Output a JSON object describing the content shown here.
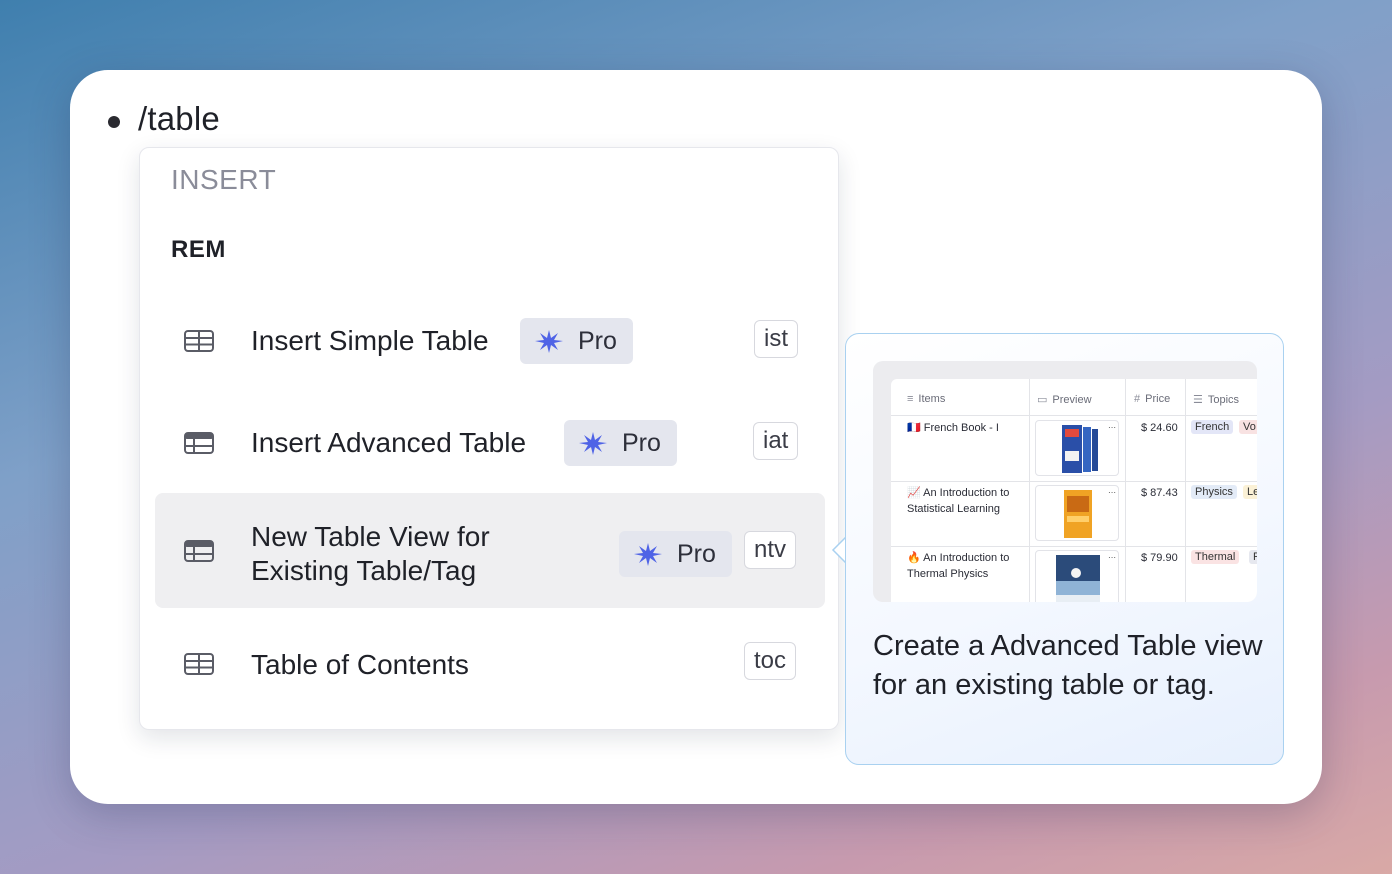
{
  "editor": {
    "command": "/table"
  },
  "menu": {
    "section": "INSERT",
    "group": "REM",
    "items": [
      {
        "label": "Insert Simple Table",
        "pro": "Pro",
        "shortcut": "ist",
        "icon": "simple-table-icon"
      },
      {
        "label": "Insert Advanced Table",
        "pro": "Pro",
        "shortcut": "iat",
        "icon": "advanced-table-icon"
      },
      {
        "label_line1": "New Table View for",
        "label_line2": "Existing Table/Tag",
        "pro": "Pro",
        "shortcut": "ntv",
        "icon": "table-view-icon",
        "selected": true
      },
      {
        "label": "Table of Contents",
        "shortcut": "toc",
        "icon": "table-of-contents-icon"
      }
    ]
  },
  "preview": {
    "description": "Create a Advanced Table view for an existing table or tag.",
    "table": {
      "headers": [
        "Items",
        "Preview",
        "Price",
        "Topics"
      ],
      "rows": [
        {
          "item": "French Book - I",
          "price": "$ 24.60",
          "tags": [
            "French",
            "Vo"
          ],
          "flag": "🇫🇷"
        },
        {
          "item_line1": "An Introduction to",
          "item_line2": "Statistical Learning",
          "price": "$ 87.43",
          "tags": [
            "Physics",
            "Le"
          ],
          "flag": "📈"
        },
        {
          "item_line1": "An Introduction to",
          "item_line2": "Thermal Physics",
          "price": "$ 79.90",
          "tags": [
            "Thermal",
            "P"
          ],
          "flag": "🔥"
        }
      ]
    }
  },
  "colors": {
    "pro_icon": "#4f63e6",
    "selected_row": "#efeff1",
    "preview_border": "#a9d1f0"
  }
}
